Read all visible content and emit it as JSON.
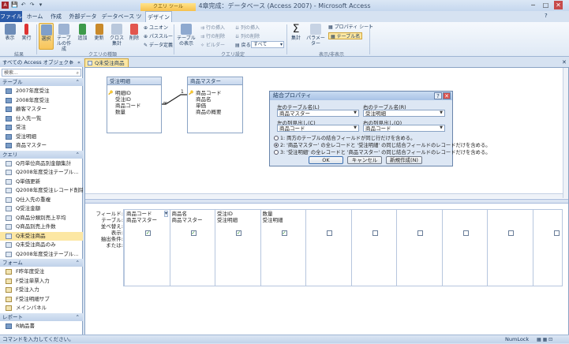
{
  "window": {
    "title": "4章完成：データベース (Access 2007) - Microsoft Access"
  },
  "quick_access": [
    "💾",
    "↶",
    "↷",
    "▾"
  ],
  "context_tab": "クエリ ツール",
  "tabs": [
    "ファイル",
    "ホーム",
    "作成",
    "外部データ",
    "データベース ツール",
    "デザイン"
  ],
  "ribbon": {
    "results": {
      "label": "結果",
      "buttons": [
        "表示",
        "実行"
      ]
    },
    "query_type": {
      "label": "クエリの種類",
      "buttons": [
        "選択",
        "テーブルの作成",
        "追加",
        "更新",
        "クロス集計",
        "削除"
      ],
      "small": [
        "ユニオン",
        "パススルー",
        "データ定義"
      ]
    },
    "setup": {
      "label": "クエリ設定",
      "big": "テーブルの表示",
      "small": [
        "行の挿入",
        "行の削除",
        "ビルダー",
        "列の挿入",
        "列の削除",
        "戻る:"
      ],
      "return_value": "すべて"
    },
    "show_hide": {
      "label": "表示/非表示",
      "buttons": [
        "集計",
        "パラメーター"
      ],
      "small": [
        "プロパティ シート",
        "テーブル名"
      ]
    }
  },
  "nav": {
    "header": "すべての Access オブジェクト",
    "search": "検索...",
    "groups": [
      {
        "name": "テーブル",
        "items": [
          "2007年度受注",
          "2008年度受注",
          "顧客マスター",
          "仕入先一覧",
          "受注",
          "受注明細",
          "商品マスター"
        ],
        "kind": "t"
      },
      {
        "name": "クエリ",
        "items": [
          "Q月単位商品別金額集計",
          "Q2008年度受注テーブル...",
          "Q単価更新",
          "Q2008年度受注レコード削除",
          "Q仕入先の重複",
          "Q受注金額",
          "Q商品分類別売上平均",
          "Q商品別売上件数",
          "Q未受注商品",
          "Q未受注商品のみ",
          "Q2008年度受注テーブル..."
        ],
        "kind": "q"
      },
      {
        "name": "フォーム",
        "items": [
          "F昨年度受注",
          "F受注単票入力",
          "F受注入力",
          "F受注明細サブ",
          "メインパネル"
        ],
        "kind": "f"
      },
      {
        "name": "レポート",
        "items": [
          "R納品書"
        ],
        "kind": "t"
      }
    ],
    "selected": "Q未受注商品"
  },
  "document_tab": "Q未受注商品",
  "tables": [
    {
      "name": "受注明細",
      "fields": [
        "明細ID",
        "受注ID",
        "商品コード",
        "数量"
      ],
      "key": [
        0
      ]
    },
    {
      "name": "商品マスター",
      "fields": [
        "商品コード",
        "商品名",
        "単価",
        "商品の概要"
      ],
      "key": [
        0
      ]
    }
  ],
  "join_labels": {
    "one": "1",
    "many": "∞"
  },
  "dialog": {
    "title": "結合プロパティ",
    "left_table_label": "左のテーブル名(L)",
    "right_table_label": "右のテーブル名(R)",
    "left_table": "商品マスター",
    "right_table": "受注明細",
    "left_column_label": "左の列見出し(C)",
    "right_column_label": "右の列見出し(O)",
    "left_column": "商品コード",
    "right_column": "商品コード",
    "options": [
      {
        "num": "1:",
        "text": "両方のテーブルの結合フィールドが同じ行だけを含める。"
      },
      {
        "num": "2:",
        "text": "'商品マスター' の全レコードと '受注明細' の同じ結合フィールドのレコードだけを含める。"
      },
      {
        "num": "3:",
        "text": "'受注明細' の全レコードと '商品マスター' の同じ結合フィールドのレコードだけを含める。"
      }
    ],
    "selected_option": 2,
    "ok": "OK",
    "cancel": "キャンセル",
    "new": "新規作成(N)",
    "help": "?",
    "close": "✕"
  },
  "grid": {
    "row_labels": [
      "フィールド:",
      "テーブル:",
      "並べ替え:",
      "表示:",
      "抽出条件:",
      "または:"
    ],
    "columns": [
      {
        "field": "商品コード",
        "table": "商品マスター",
        "show": true
      },
      {
        "field": "商品名",
        "table": "商品マスター",
        "show": true
      },
      {
        "field": "受注ID",
        "table": "受注明細",
        "show": true
      },
      {
        "field": "数量",
        "table": "受注明細",
        "show": true
      },
      {
        "field": "",
        "table": "",
        "show": false
      },
      {
        "field": "",
        "table": "",
        "show": false
      },
      {
        "field": "",
        "table": "",
        "show": false
      },
      {
        "field": "",
        "table": "",
        "show": false
      },
      {
        "field": "",
        "table": "",
        "show": false
      },
      {
        "field": "",
        "table": "",
        "show": false
      }
    ]
  },
  "status": {
    "left": "コマンドを入力してください。",
    "right": "NumLock"
  }
}
